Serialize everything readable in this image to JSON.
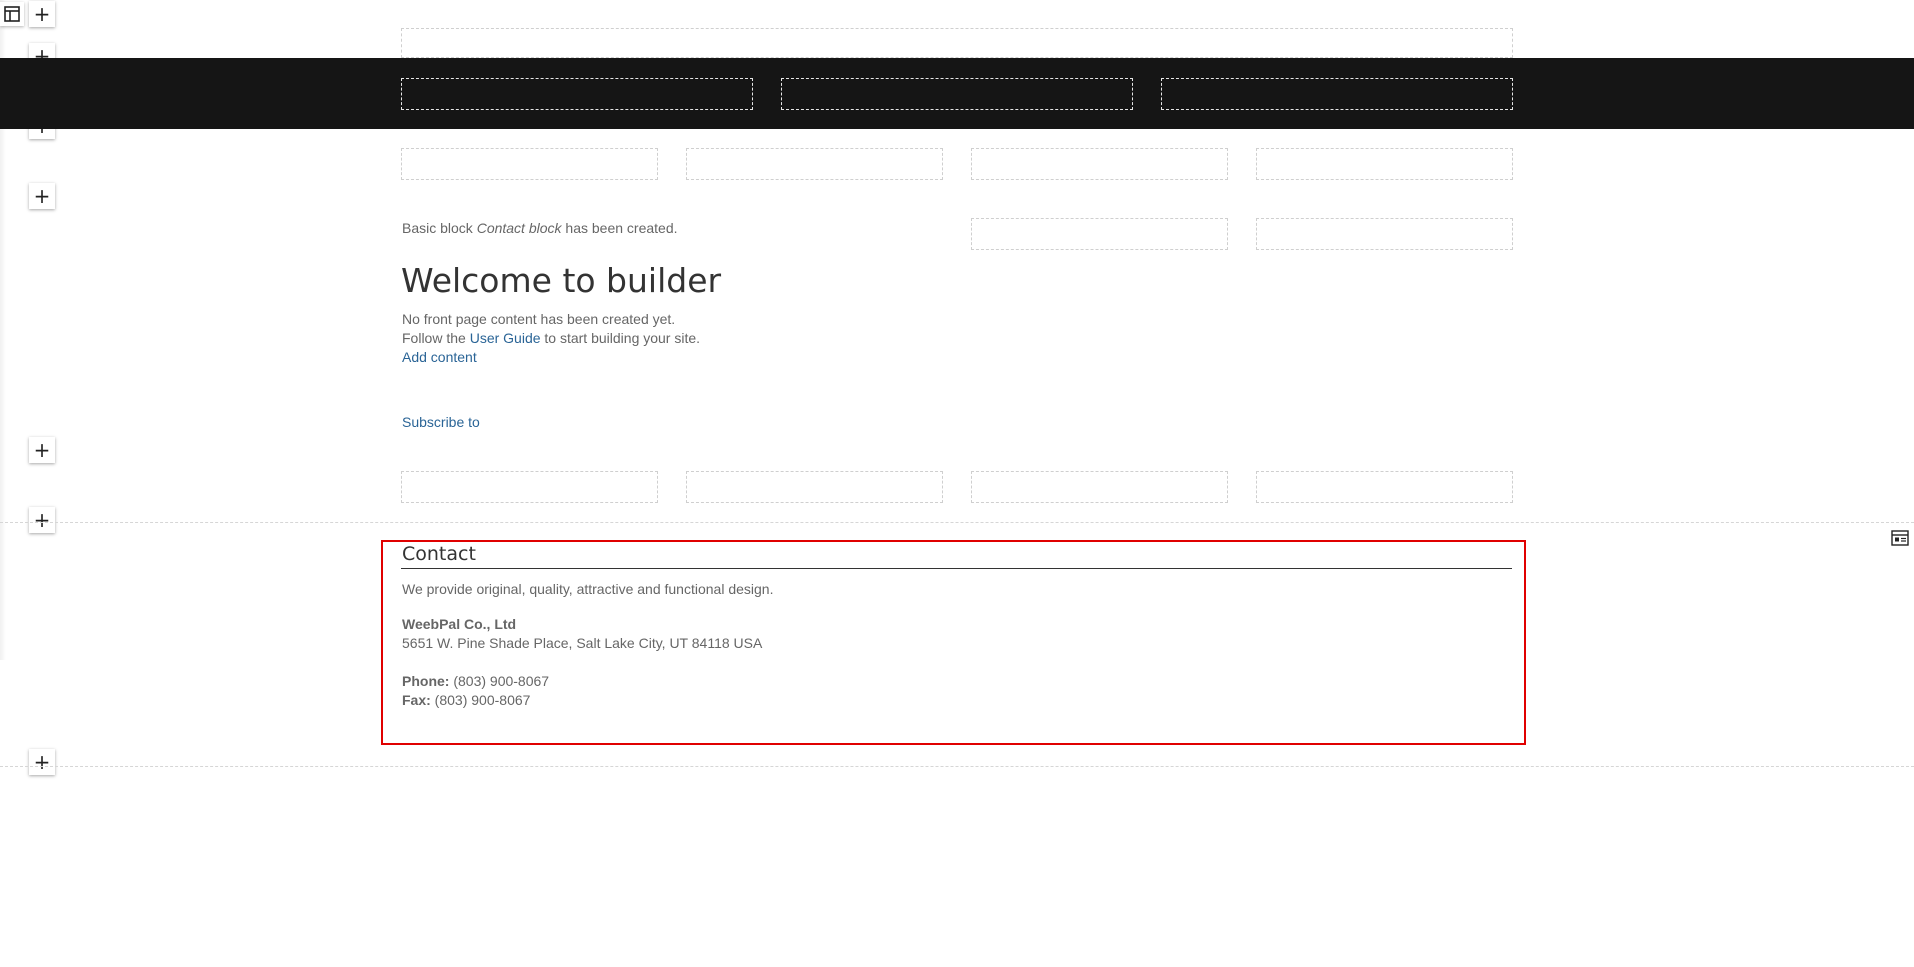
{
  "toolbar": {
    "layout_icon": "layout-icon",
    "add_label": "+"
  },
  "main": {
    "status_prefix": "Basic block ",
    "status_block_name": "Contact block",
    "status_suffix": " has been created.",
    "heading": "Welcome to builder",
    "no_content_text": "No front page content has been created yet.",
    "follow_prefix": "Follow the ",
    "user_guide_link": "User Guide",
    "follow_suffix": " to start building your site.",
    "add_content_link": "Add content",
    "subscribe_link": "Subscribe to"
  },
  "contact": {
    "title": "Contact",
    "description": "We provide original, quality, attractive and functional design.",
    "company": "WeebPal Co., Ltd",
    "address": "5651 W. Pine Shade Place, Salt Lake City, UT 84118 USA",
    "phone_label": "Phone:",
    "phone_value": " (803) 900-8067",
    "fax_label": "Fax:",
    "fax_value": " (803) 900-8067"
  },
  "right_edge": {
    "icon": "block-settings-icon"
  },
  "colors": {
    "accent_border": "#e00000",
    "link": "#2a6496",
    "dark_band": "#151515"
  }
}
